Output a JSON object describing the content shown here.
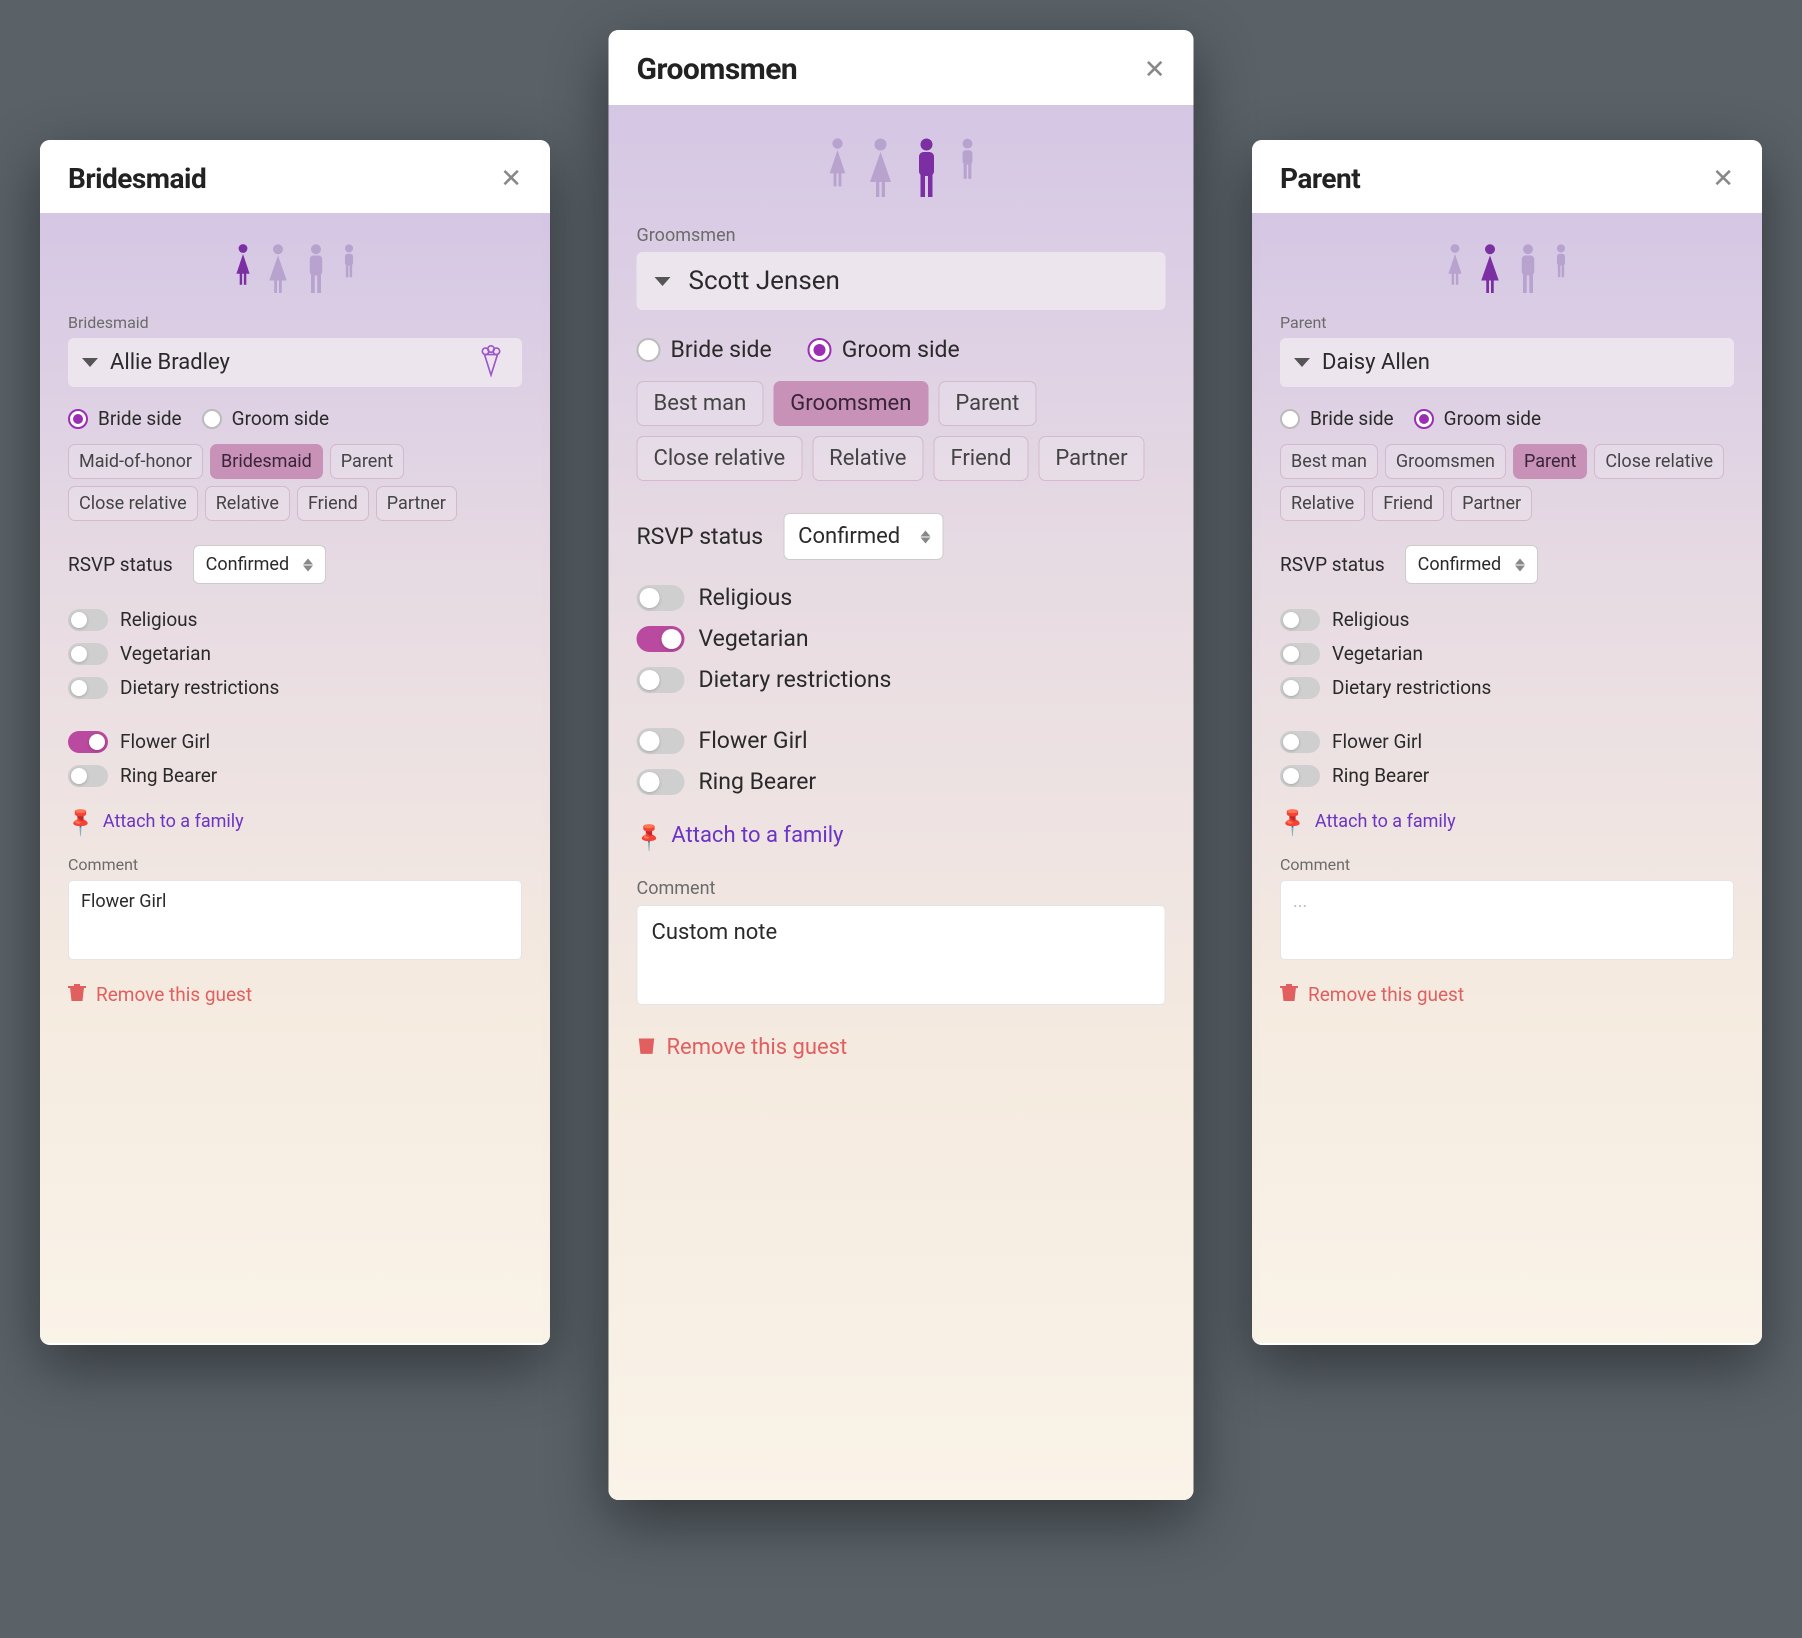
{
  "labels": {
    "rsvp": "RSVP status",
    "attach": "Attach to a family",
    "comment": "Comment",
    "remove": "Remove this guest",
    "comment_placeholder": "..."
  },
  "side_options": {
    "bride": "Bride side",
    "groom": "Groom side"
  },
  "role_options_bride": [
    "Maid-of-honor",
    "Bridesmaid",
    "Parent",
    "Close relative",
    "Relative",
    "Friend",
    "Partner"
  ],
  "role_options_groom": [
    "Best man",
    "Groomsmen",
    "Parent",
    "Close relative",
    "Relative",
    "Friend",
    "Partner"
  ],
  "toggles_diet": [
    "Religious",
    "Vegetarian",
    "Dietary restrictions"
  ],
  "toggles_role": [
    "Flower Girl",
    "Ring Bearer"
  ],
  "cards": {
    "left": {
      "title": "Bridesmaid",
      "role_label": "Bridesmaid",
      "name": "Allie Bradley",
      "has_bouquet": true,
      "side": "bride",
      "selected_role": "Bridesmaid",
      "role_set": "bride",
      "rsvp": "Confirmed",
      "toggles": {
        "Religious": false,
        "Vegetarian": false,
        "Dietary restrictions": false,
        "Flower Girl": true,
        "Ring Bearer": false
      },
      "comment": "Flower Girl",
      "selected_person_index": 0
    },
    "center": {
      "title": "Groomsmen",
      "role_label": "Groomsmen",
      "name": "Scott Jensen",
      "has_bouquet": false,
      "side": "groom",
      "selected_role": "Groomsmen",
      "role_set": "groom",
      "rsvp": "Confirmed",
      "toggles": {
        "Religious": false,
        "Vegetarian": true,
        "Dietary restrictions": false,
        "Flower Girl": false,
        "Ring Bearer": false
      },
      "comment": "Custom note",
      "selected_person_index": 2
    },
    "right": {
      "title": "Parent",
      "role_label": "Parent",
      "name": "Daisy Allen",
      "has_bouquet": false,
      "side": "groom",
      "selected_role": "Parent",
      "role_set": "groom",
      "rsvp": "Confirmed",
      "toggles": {
        "Religious": false,
        "Vegetarian": false,
        "Dietary restrictions": false,
        "Flower Girl": false,
        "Ring Bearer": false
      },
      "comment": "",
      "selected_person_index": 1
    }
  }
}
